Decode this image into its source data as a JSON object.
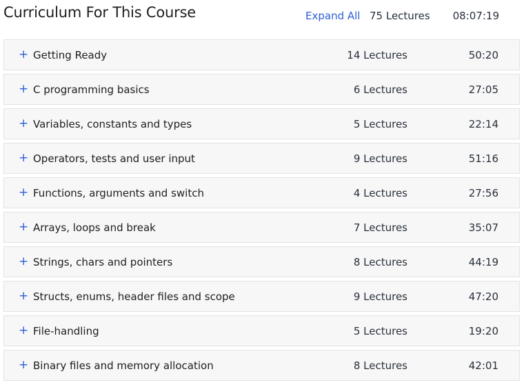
{
  "header": {
    "title": "Curriculum For This Course",
    "expand_all_label": "Expand All",
    "total_lectures": "75 Lectures",
    "total_duration": "08:07:19"
  },
  "colors": {
    "accent": "#2d5fd6",
    "row_background": "#f7f7f7",
    "row_border": "#e3e3e3"
  },
  "expand_icon": "plus-icon",
  "sections": [
    {
      "icon": "+",
      "title": "Getting Ready",
      "lectures": "14 Lectures",
      "duration": "50:20"
    },
    {
      "icon": "+",
      "title": "C programming basics",
      "lectures": "6 Lectures",
      "duration": "27:05"
    },
    {
      "icon": "+",
      "title": "Variables, constants and types",
      "lectures": "5 Lectures",
      "duration": "22:14"
    },
    {
      "icon": "+",
      "title": "Operators, tests and user input",
      "lectures": "9 Lectures",
      "duration": "51:16"
    },
    {
      "icon": "+",
      "title": "Functions, arguments and switch",
      "lectures": "4 Lectures",
      "duration": "27:56"
    },
    {
      "icon": "+",
      "title": "Arrays, loops and break",
      "lectures": "7 Lectures",
      "duration": "35:07"
    },
    {
      "icon": "+",
      "title": "Strings, chars and pointers",
      "lectures": "8 Lectures",
      "duration": "44:19"
    },
    {
      "icon": "+",
      "title": "Structs, enums, header files and scope",
      "lectures": "9 Lectures",
      "duration": "47:20"
    },
    {
      "icon": "+",
      "title": "File-handling",
      "lectures": "5 Lectures",
      "duration": "19:20"
    },
    {
      "icon": "+",
      "title": "Binary files and memory allocation",
      "lectures": "8 Lectures",
      "duration": "42:01"
    }
  ]
}
